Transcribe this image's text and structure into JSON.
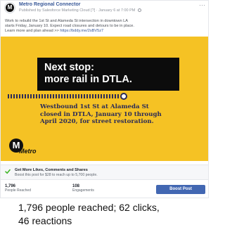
{
  "post": {
    "page_name": "Metro Regional Connector",
    "meta": "Published by Salesforce Marketing Cloud [?] · January 6 at 7:00 PM",
    "text_lines": [
      "Work to rebuild the 1st St and Alameda St intersection in downtown LA",
      "starts Friday, January 10. Expect road closures and detours to be in place.",
      "Learn more and plan ahead >> "
    ],
    "link_text": "https://bddy.me/2sBV5z7",
    "more_glyph": "···",
    "avatar_letter": "M"
  },
  "promo": {
    "headline_line1": "Next stop:",
    "headline_line2": "more rail in DTLA.",
    "announcement_lines": [
      "Westbound 1st St at Alameda St",
      "closed in DTLA, January 10 through",
      "April 2020, for street restoration."
    ],
    "logo_letter": "M",
    "logo_word": "Metro",
    "colors": {
      "background": "#f5c224",
      "headline_box": "#0c0c0c",
      "route": "#2b2b57"
    }
  },
  "boost": {
    "title": "Get More Likes, Comments and Shares",
    "subtitle": "Boost this post for $28 to reach up to 5,700 people."
  },
  "stats": {
    "reached_value": "1,796",
    "reached_label": "People Reached",
    "engagements_value": "108",
    "engagements_label": "Engagements",
    "boost_button": "Boost Post"
  },
  "caption": {
    "line1": "1,796 people reached; 62 clicks,",
    "line2": "46 reactions"
  }
}
